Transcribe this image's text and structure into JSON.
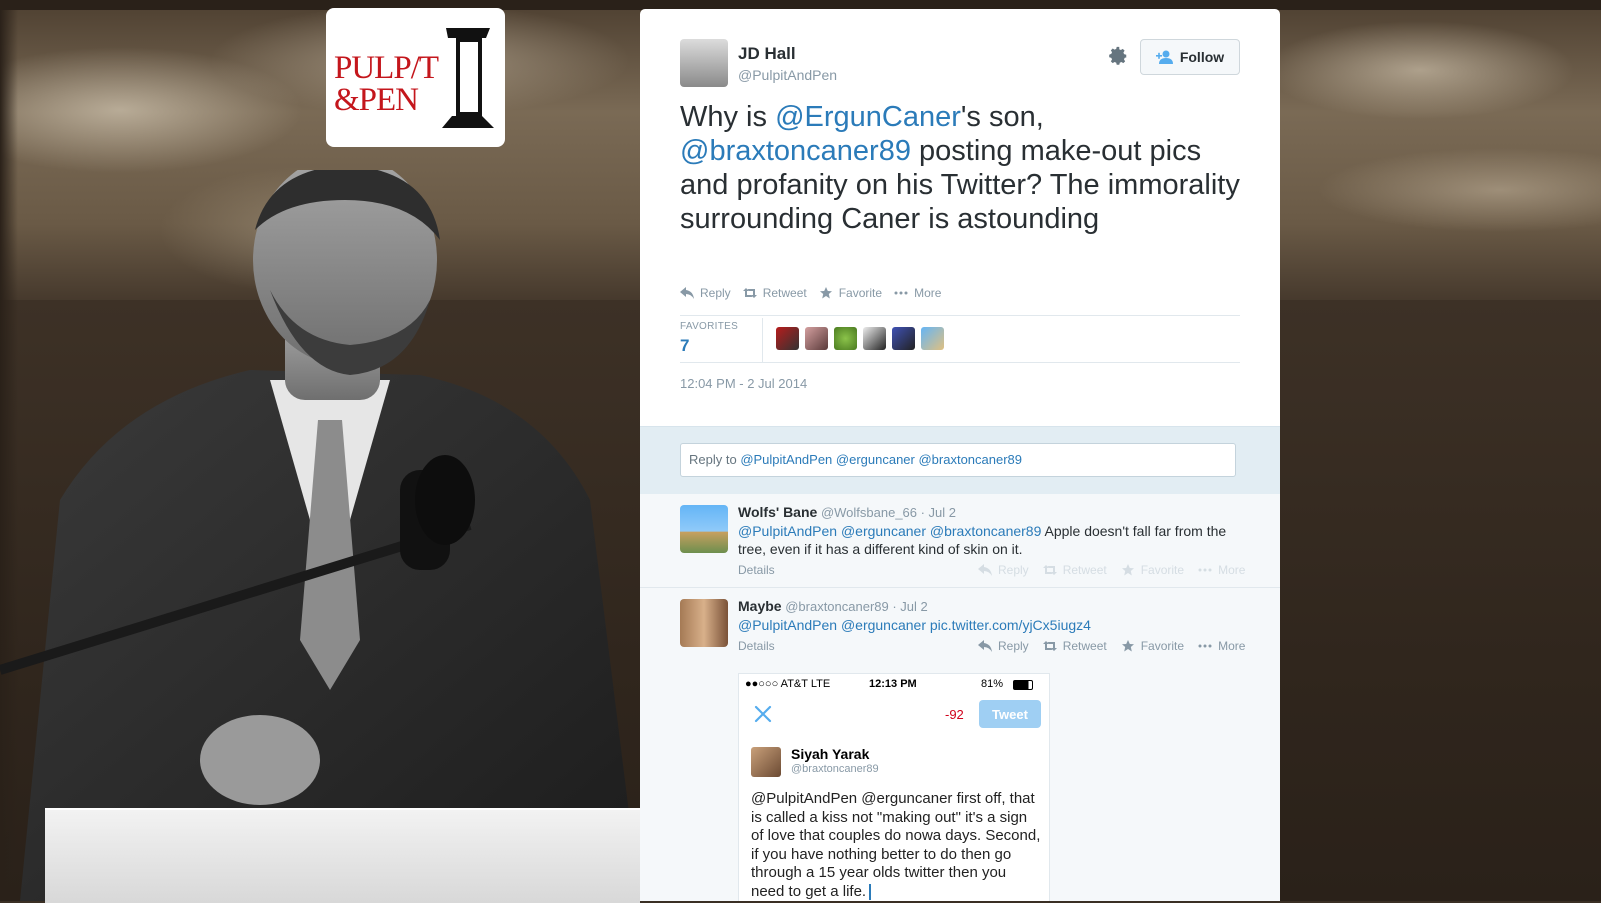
{
  "logo": {
    "line1": "PULP/T",
    "line2": "&PEN"
  },
  "tweet": {
    "author_name": "JD Hall",
    "author_handle": "@PulpitAndPen",
    "follow_label": "Follow",
    "text_pre": "Why is ",
    "mention1": "@ErgunCaner",
    "text_mid": "'s son, ",
    "mention2": "@braxtoncaner89",
    "text_post": " posting make-out pics and profanity on his Twitter? The immorality surrounding Caner is astounding",
    "actions": {
      "reply": "Reply",
      "retweet": "Retweet",
      "favorite": "Favorite",
      "more": "More"
    },
    "favorites_label": "FAVORITES",
    "favorites_count": "7",
    "timestamp": "12:04 PM - 2 Jul 2014"
  },
  "reply_box": {
    "prefix": "Reply to ",
    "mentions": "@PulpitAndPen @erguncaner @braxtoncaner89"
  },
  "replies": [
    {
      "name": "Wolfs' Bane",
      "meta": "@Wolfsbane_66 · Jul 2",
      "mentions": "@PulpitAndPen @erguncaner @braxtoncaner89",
      "text": " Apple doesn't fall far from the tree, even if it has a different kind of skin on it.",
      "details": "Details"
    },
    {
      "name": "Maybe",
      "meta": "@braxtoncaner89 · Jul 2",
      "mentions": "@PulpitAndPen @erguncaner pic.twitter.com/yjCx5iugz4",
      "text": "",
      "details": "Details"
    }
  ],
  "phone": {
    "carrier": "●●○○○ AT&T  LTE",
    "time": "12:13 PM",
    "battery": "81%",
    "char_count": "-92",
    "tweet_button": "Tweet",
    "name": "Siyah Yarak",
    "handle": "@braxtoncaner89",
    "text": "@PulpitAndPen @erguncaner first off, that is called a kiss not \"making out\" it's a sign of love that couples do nowa days. Second, if you have nothing better to do then go through a 15 year olds twitter then you need to get a life."
  },
  "colors": {
    "link": "#2b7bb9",
    "text": "#292f33",
    "muted": "#8899a6",
    "logo_red": "#c4161c"
  },
  "icons": [
    "gear-icon",
    "follow-person-icon",
    "reply-icon",
    "retweet-icon",
    "star-icon",
    "more-icon",
    "close-icon"
  ]
}
